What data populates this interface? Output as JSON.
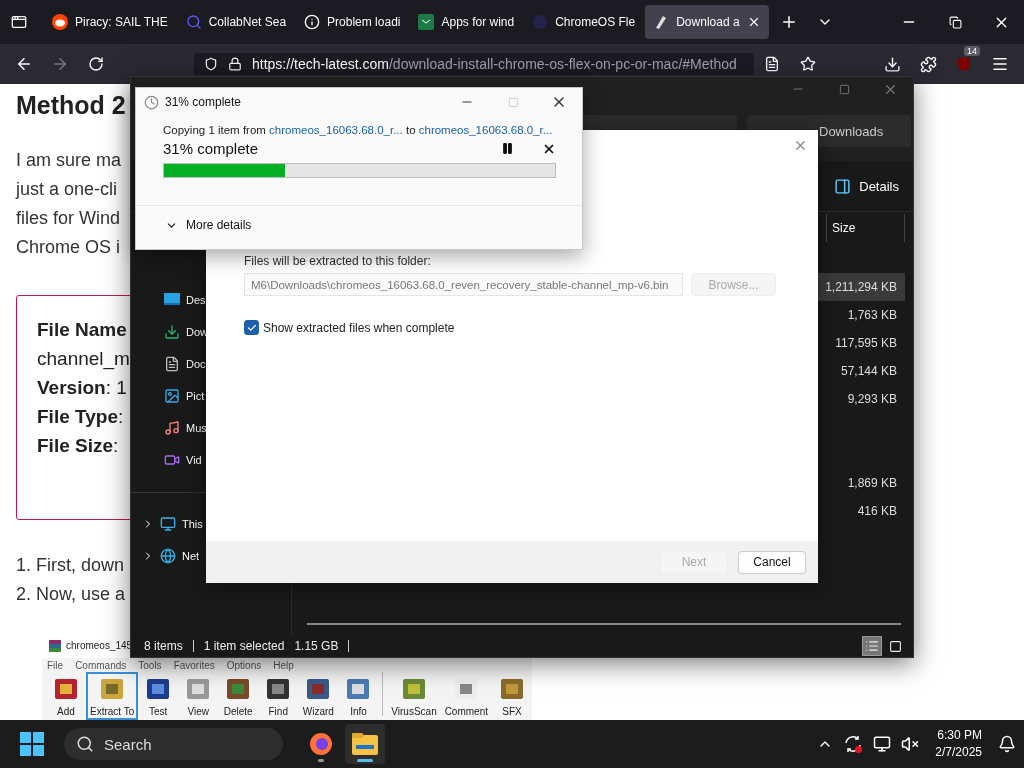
{
  "browser": {
    "tabs": [
      {
        "label": "Piracy: SAIL THE",
        "kind": "alien",
        "selected": false
      },
      {
        "label": "CollabNet Sea",
        "kind": "search",
        "selected": false
      },
      {
        "label": "Problem loadi",
        "kind": "info",
        "selected": false
      },
      {
        "label": "Apps for wind",
        "kind": "store",
        "selected": false
      },
      {
        "label": "ChromeOS Fle",
        "kind": "circle",
        "selected": false
      },
      {
        "label": "Download a",
        "kind": "page",
        "selected": true
      }
    ],
    "url_host": "https://tech-latest.com",
    "url_path": "/download-install-chrome-os-flex-on-pc-or-mac/#Method",
    "extension_badge": "14",
    "page": {
      "heading": "Method 2",
      "paragraph_lines": [
        "I am sure ma",
        "just a one-cli",
        "files for Wind",
        "Chrome OS i"
      ],
      "info_lines": [
        "**File Name**",
        "channel_m",
        "**Version**: 1",
        "**File Type**:",
        "**File Size**:"
      ],
      "list_items": [
        "1. First, down",
        "2. Now, use a"
      ],
      "winrar": {
        "title": "chromeos_145",
        "menu": [
          "File",
          "Commands",
          "Tools",
          "Favorites",
          "Options",
          "Help"
        ],
        "tools": [
          {
            "label": "Add",
            "selected": false
          },
          {
            "label": "Extract To",
            "selected": true
          },
          {
            "label": "Test",
            "selected": false
          },
          {
            "label": "View",
            "selected": false
          },
          {
            "label": "Delete",
            "selected": false
          },
          {
            "label": "Find",
            "selected": false
          },
          {
            "label": "Wizard",
            "selected": false
          },
          {
            "label": "Info",
            "selected": false
          },
          {
            "label": "VirusScan",
            "selected": false
          },
          {
            "label": "Comment",
            "selected": false
          },
          {
            "label": "SFX",
            "selected": false
          }
        ]
      }
    }
  },
  "explorer": {
    "search": "Downloads",
    "details_button": "Details",
    "quick_access": [
      {
        "label": "Des",
        "kind": "desktop"
      },
      {
        "label": "Dow",
        "kind": "downloads"
      },
      {
        "label": "Doc",
        "kind": "documents"
      },
      {
        "label": "Pict",
        "kind": "pictures"
      },
      {
        "label": "Mus",
        "kind": "music"
      },
      {
        "label": "Vid",
        "kind": "videos"
      }
    ],
    "locations": [
      {
        "label": "This",
        "kind": "pc",
        "expanded": false
      },
      {
        "label": "Net",
        "kind": "network",
        "expanded": false
      }
    ],
    "size_header": "Size",
    "rows": [
      {
        "size": "1,211,294 KB",
        "selected": true
      },
      {
        "size": "1,763 KB",
        "selected": false
      },
      {
        "size": "117,595 KB",
        "selected": false
      },
      {
        "size": "57,144 KB",
        "selected": false
      },
      {
        "size": "9,293 KB",
        "selected": false
      },
      {
        "selected": false
      },
      {
        "selected": false
      },
      {
        "size": "1,869 KB",
        "selected": false
      },
      {
        "size": "416 KB",
        "selected": false
      }
    ],
    "status": {
      "count": "8 items",
      "selection": "1 item selected",
      "selection_size": "1.15 GB"
    },
    "view_buttons": [
      {
        "kind": "details",
        "selected": true
      },
      {
        "kind": "tiles",
        "selected": false
      }
    ]
  },
  "extract_dialog": {
    "folder_label": "Files will be extracted to this folder:",
    "folder_path": "M6\\Downloads\\chromeos_16063.68.0_reven_recovery_stable-channel_mp-v6.bin",
    "browse": {
      "label": "Browse...",
      "disabled": true
    },
    "show_files": {
      "label": "Show extracted files when complete",
      "checked": true
    },
    "buttons": [
      {
        "label": "Next",
        "disabled": true
      },
      {
        "label": "Cancel",
        "disabled": false
      }
    ]
  },
  "copy_dialog": {
    "title": "31% complete",
    "prefix": "Copying 1 item from",
    "source": "chromeos_16063.68.0_r...",
    "joiner": "to",
    "dest": "chromeos_16063.68.0_r...",
    "status": "31% complete",
    "level": 0.31,
    "more_details": "More details",
    "expanded": false
  },
  "taskbar": {
    "search": "Search",
    "apps": [
      {
        "kind": "firefox",
        "active": false
      },
      {
        "kind": "explorer",
        "active": true
      }
    ],
    "time": "6:30 PM",
    "date": "2/7/2025"
  }
}
